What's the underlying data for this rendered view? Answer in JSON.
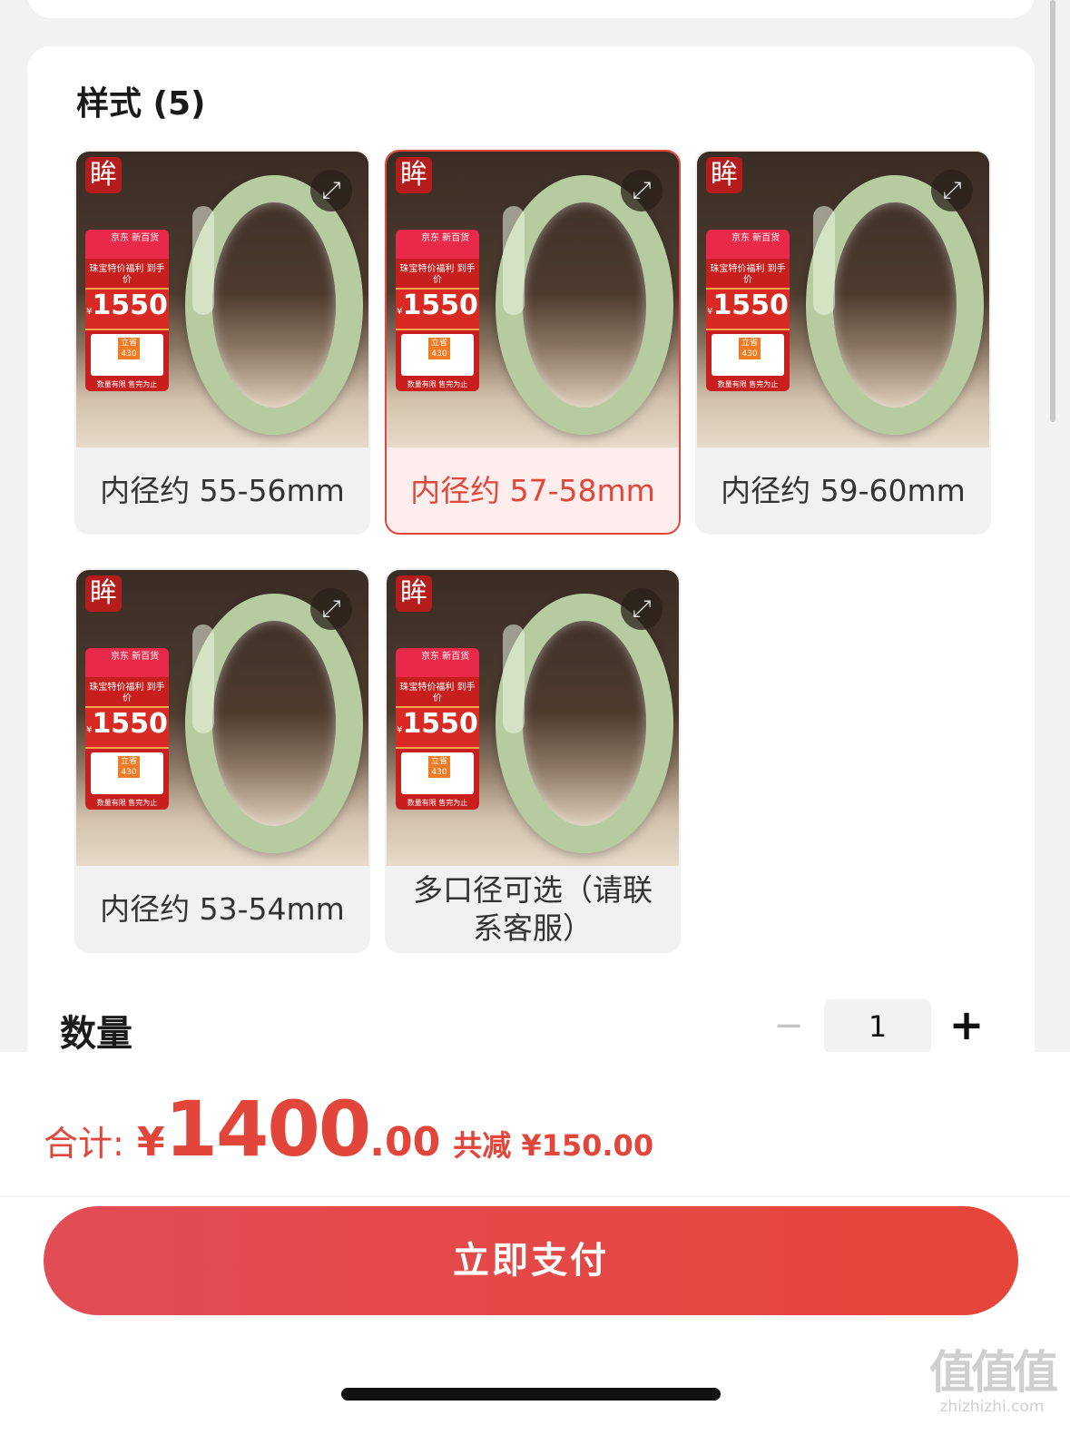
{
  "style_section": {
    "title": "样式 (5)"
  },
  "options": [
    {
      "label": "内径约 55-56mm",
      "selected": false
    },
    {
      "label": "内径约 57-58mm",
      "selected": true
    },
    {
      "label": "内径约 59-60mm",
      "selected": false
    },
    {
      "label": "内径约 53-54mm",
      "selected": false
    },
    {
      "label": "多口径可选（请联系客服）",
      "selected": false
    }
  ],
  "product_image": {
    "brand_badge": "眸",
    "expand_icon": "expand-icon",
    "promo": {
      "store_name": "京东 新百货",
      "headline": "珠宝特价福利 到手价",
      "currency": "¥",
      "price": "1550",
      "coupon_label": "立省",
      "coupon_value": "430",
      "subsidy": "限时补贴",
      "footer": "数量有限 售完为止"
    }
  },
  "quantity": {
    "label": "数量",
    "value": "1",
    "minus": "−",
    "plus": "+"
  },
  "total": {
    "label": "合计:",
    "currency": "¥",
    "integer": "1400",
    "decimal": ".00",
    "discount": "共减 ¥150.00"
  },
  "pay_button": {
    "label": "立即支付"
  },
  "watermark": {
    "logo": "值值值",
    "domain": "zhizhizhi.com"
  },
  "colors": {
    "accent": "#e2463a",
    "selected_bg": "#fdeeed",
    "badge": "#b51d1d"
  }
}
